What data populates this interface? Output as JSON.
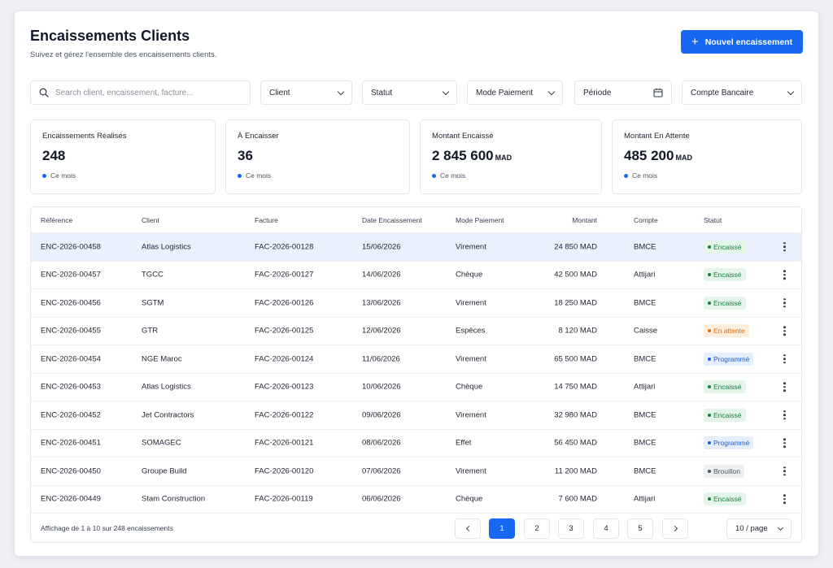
{
  "header": {
    "title": "Encaissements Clients",
    "subtitle": "Suivez et gérez l'ensemble des encaissements clients.",
    "new_button": "Nouvel encaissement"
  },
  "filters": {
    "search_placeholder": "Search client, encaissement, facture...",
    "client": "Client",
    "statut": "Statut",
    "mode": "Mode Paiement",
    "periode": "Période",
    "compte": "Compte Bancaire"
  },
  "kpis": [
    {
      "label": "Encaissements Réalisés",
      "value": "248",
      "unit": "",
      "period": "Ce mois"
    },
    {
      "label": "À Encaisser",
      "value": "36",
      "unit": "",
      "period": "Ce mois"
    },
    {
      "label": "Montant Encaissé",
      "value": "2 845 600",
      "unit": "MAD",
      "period": "Ce mois"
    },
    {
      "label": "Montant En Attente",
      "value": "485 200",
      "unit": "MAD",
      "period": "Ce mois"
    }
  ],
  "table": {
    "columns": [
      "Référence",
      "Client",
      "Facture",
      "Date Encaissement",
      "Mode Paiement",
      "Montant",
      "Compte",
      "Statut"
    ],
    "rows": [
      {
        "ref": "ENC-2026-00458",
        "client": "Atlas Logistics",
        "facture": "FAC-2026-00128",
        "date": "15/06/2026",
        "mode": "Virement",
        "montant": "24 850 MAD",
        "compte": "BMCE",
        "statut": "Encaissé",
        "kind": "encaisse"
      },
      {
        "ref": "ENC-2026-00457",
        "client": "TGCC",
        "facture": "FAC-2026-00127",
        "date": "14/06/2026",
        "mode": "Chèque",
        "montant": "42 500 MAD",
        "compte": "Attijari",
        "statut": "Encaissé",
        "kind": "encaisse"
      },
      {
        "ref": "ENC-2026-00456",
        "client": "SGTM",
        "facture": "FAC-2026-00126",
        "date": "13/06/2026",
        "mode": "Virement",
        "montant": "18 250 MAD",
        "compte": "BMCE",
        "statut": "Encaissé",
        "kind": "encaisse"
      },
      {
        "ref": "ENC-2026-00455",
        "client": "GTR",
        "facture": "FAC-2026-00125",
        "date": "12/06/2026",
        "mode": "Espèces",
        "montant": "8 120 MAD",
        "compte": "Caisse",
        "statut": "En attente",
        "kind": "attente"
      },
      {
        "ref": "ENC-2026-00454",
        "client": "NGE Maroc",
        "facture": "FAC-2026-00124",
        "date": "11/06/2026",
        "mode": "Virement",
        "montant": "65 500 MAD",
        "compte": "BMCE",
        "statut": "Programmé",
        "kind": "programme"
      },
      {
        "ref": "ENC-2026-00453",
        "client": "Atlas Logistics",
        "facture": "FAC-2026-00123",
        "date": "10/06/2026",
        "mode": "Chèque",
        "montant": "14 750 MAD",
        "compte": "Attijari",
        "statut": "Encaissé",
        "kind": "encaisse"
      },
      {
        "ref": "ENC-2026-00452",
        "client": "Jet Contractors",
        "facture": "FAC-2026-00122",
        "date": "09/06/2026",
        "mode": "Virement",
        "montant": "32 980 MAD",
        "compte": "BMCE",
        "statut": "Encaissé",
        "kind": "encaisse"
      },
      {
        "ref": "ENC-2026-00451",
        "client": "SOMAGEC",
        "facture": "FAC-2026-00121",
        "date": "08/06/2026",
        "mode": "Effet",
        "montant": "56 450 MAD",
        "compte": "BMCE",
        "statut": "Programmé",
        "kind": "programme"
      },
      {
        "ref": "ENC-2026-00450",
        "client": "Groupe Build",
        "facture": "FAC-2026-00120",
        "date": "07/06/2026",
        "mode": "Virement",
        "montant": "11 200 MAD",
        "compte": "BMCE",
        "statut": "Brouillon",
        "kind": "brouillon"
      },
      {
        "ref": "ENC-2026-00449",
        "client": "Stam Construction",
        "facture": "FAC-2026-00119",
        "date": "06/06/2026",
        "mode": "Chèque",
        "montant": "7 600 MAD",
        "compte": "Attijari",
        "statut": "Encaissé",
        "kind": "encaisse"
      }
    ]
  },
  "footer": {
    "info": "Affichage de 1 à 10 sur 248 encaissements",
    "pages": [
      "1",
      "2",
      "3",
      "4",
      "5"
    ],
    "per_page": "10 / page"
  },
  "colors": {
    "accent": "#1668f2",
    "encaisse": "#15803d",
    "attente": "#e36b0a",
    "programme": "#1d5fd8",
    "brouillon": "#4b5563"
  }
}
